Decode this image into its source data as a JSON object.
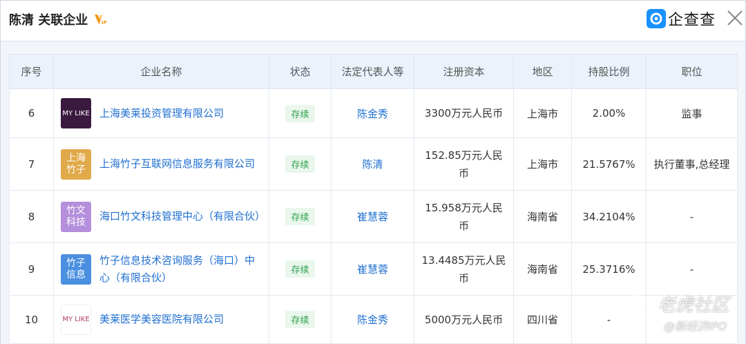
{
  "header": {
    "title": "陈清 关联企业",
    "vip_icon": "vip-badge-icon",
    "brand_text": "企查查",
    "close_icon": "close-icon"
  },
  "table": {
    "columns": [
      "序号",
      "企业名称",
      "状态",
      "法定代表人等",
      "注册资本",
      "地区",
      "持股比例",
      "职位"
    ],
    "rows": [
      {
        "index": "6",
        "logo_text": "MY LIKE",
        "company": "上海美莱投资管理有限公司",
        "status": "存续",
        "legal_rep": "陈金秀",
        "capital": "3300万元人民币",
        "region": "上海市",
        "ratio": "2.00%",
        "position": "监事"
      },
      {
        "index": "7",
        "logo_text": "上海竹子",
        "company": "上海竹子互联网信息服务有限公司",
        "status": "存续",
        "legal_rep": "陈清",
        "capital": "152.85万元人民币",
        "region": "上海市",
        "ratio": "21.5767%",
        "position": "执行董事,总经理"
      },
      {
        "index": "8",
        "logo_text": "竹文科技",
        "company": "海口竹文科技管理中心（有限合伙）",
        "status": "存续",
        "legal_rep": "崔慧蓉",
        "capital": "15.958万元人民币",
        "region": "海南省",
        "ratio": "34.2104%",
        "position": "-"
      },
      {
        "index": "9",
        "logo_text": "竹子信息",
        "company": "竹子信息技术咨询服务（海口）中心（有限合伙）",
        "status": "存续",
        "legal_rep": "崔慧蓉",
        "capital": "13.4485万元人民币",
        "region": "海南省",
        "ratio": "25.3716%",
        "position": "-"
      },
      {
        "index": "10",
        "logo_text": "MY LIKE",
        "company": "美莱医学美容医院有限公司",
        "status": "存续",
        "legal_rep": "陈金秀",
        "capital": "5000万元人民币",
        "region": "四川省",
        "ratio": "-",
        "position": ""
      }
    ]
  },
  "watermark": {
    "line1": "老虎社区",
    "line2": "@新经济IPO"
  },
  "colors": {
    "link": "#1f6fd1",
    "status_bg": "#e9f7ec",
    "status_text": "#2aa04a",
    "header_bg": "#ebf2fb",
    "brand": "#1891ff"
  }
}
